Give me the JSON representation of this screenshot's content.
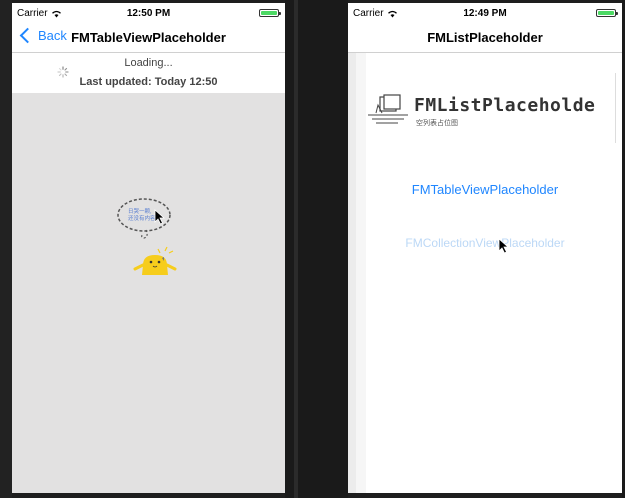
{
  "left_screen": {
    "status": {
      "carrier": "Carrier",
      "time": "12:50 PM"
    },
    "nav": {
      "back_label": "Back",
      "title": "FMTableViewPlaceholder"
    },
    "refresh": {
      "loading_text": "Loading...",
      "updated_text": "Last updated: Today 12:50"
    },
    "placeholder": {
      "bubble_line1": "日哭一颗,",
      "bubble_line2": "还没有内容呢"
    }
  },
  "right_screen": {
    "status": {
      "carrier": "Carrier",
      "time": "12:49 PM"
    },
    "nav": {
      "title": "FMListPlaceholder"
    },
    "logo": {
      "text": "FMListPlaceholde",
      "subtitle": "空列表占位图"
    },
    "links": [
      "FMTableViewPlaceholder",
      "FMCollectionViewPlaceholder"
    ]
  },
  "colors": {
    "accent": "#1f86ff",
    "battery": "#4cd964",
    "placeholder_bg": "#e2e1e1",
    "mascot": "#f6cd1c"
  }
}
